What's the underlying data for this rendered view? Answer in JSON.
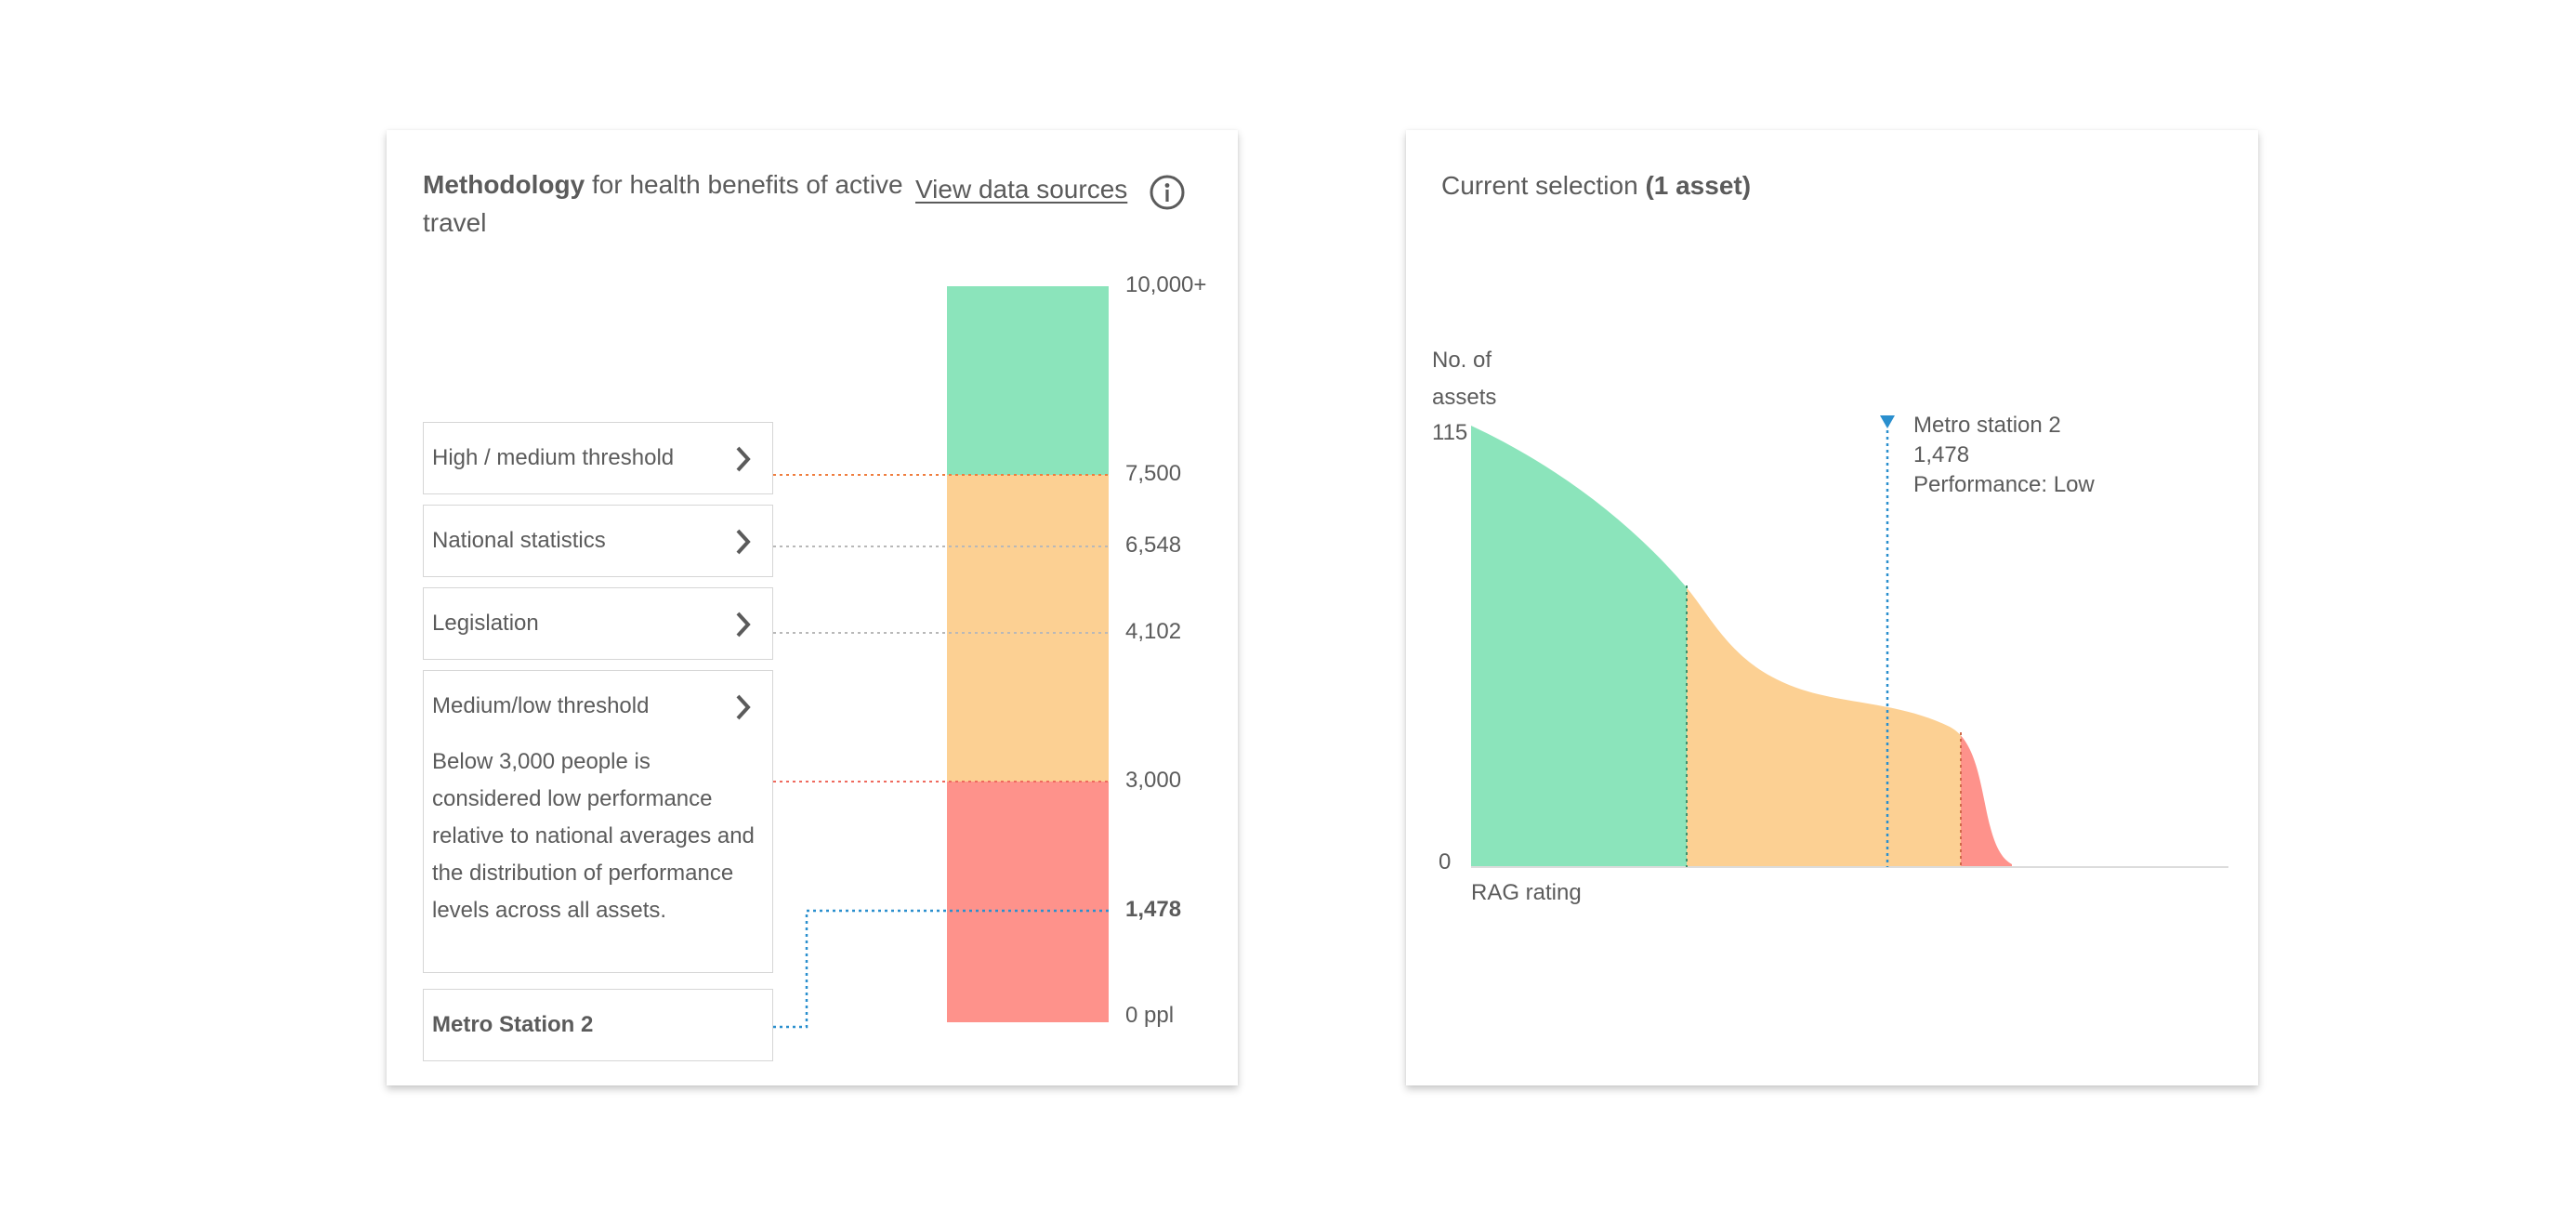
{
  "methodology": {
    "title_bold": "Methodology",
    "title_rest": " for health benefits of active travel",
    "view_data_sources": "View data sources",
    "info_icon": "info-circle-icon",
    "items": [
      {
        "label": "High / medium threshold"
      },
      {
        "label": "National statistics"
      },
      {
        "label": "Legislation"
      },
      {
        "label": "Medium/low threshold",
        "description": "Below 3,000 people is considered low performance relative to national averages and the distribution of performance levels across all assets."
      },
      {
        "label": "Metro Station 2"
      }
    ],
    "scale": {
      "labels": [
        "10,000+",
        "7,500",
        "6,548",
        "4,102",
        "3,000",
        "1,478",
        "0 ppl"
      ],
      "colors": {
        "green": "#8be4bb",
        "amber": "#fcd093",
        "red": "#fe928b",
        "line_high": "#ef7d3e",
        "line_neutral": "#b8b8b8",
        "line_low": "#ef6a5e",
        "line_selected": "#2a8fce"
      }
    }
  },
  "selection": {
    "title_prefix": "Current selection ",
    "title_bold": "(1 asset)",
    "chart": {
      "ylabel": "No. of assets",
      "y_max": "115",
      "y_min": "0",
      "xlabel": "RAG rating",
      "marker": {
        "name": "Metro station 2",
        "value": "1,478",
        "performance": "Performance: Low"
      }
    }
  }
}
